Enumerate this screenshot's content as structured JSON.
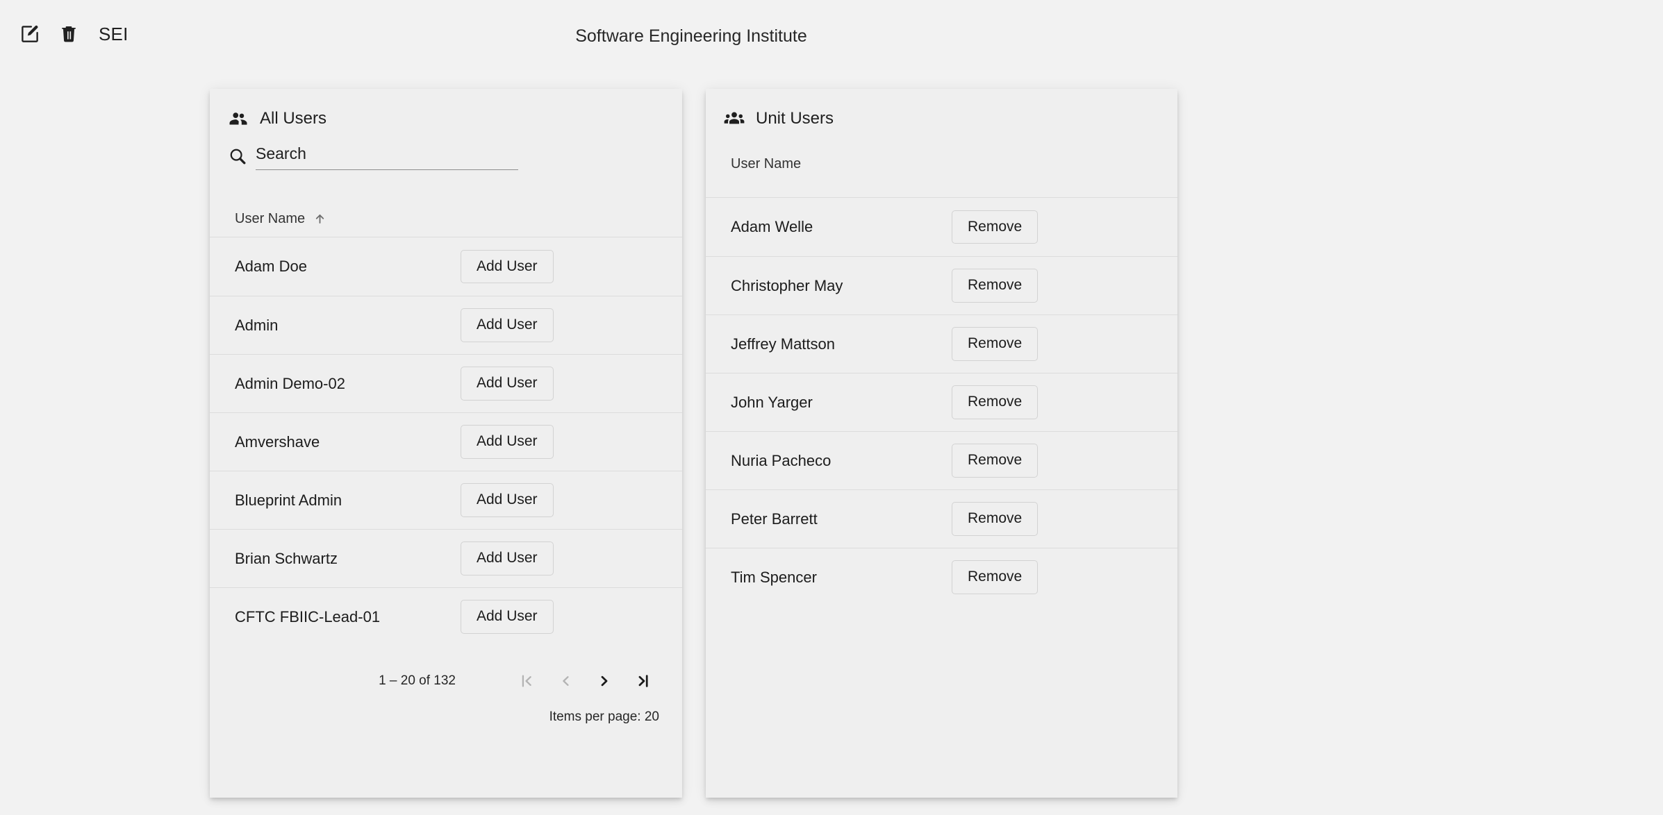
{
  "header": {
    "title": "Software Engineering Institute",
    "org_label": "SEI",
    "edit_icon": "edit-square-icon",
    "delete_icon": "trash-icon"
  },
  "all_users_panel": {
    "icon": "people-icon",
    "title": "All Users",
    "search": {
      "icon": "search-icon",
      "placeholder": "Search",
      "value": ""
    },
    "column_header": {
      "label": "User Name",
      "sort_icon": "arrow-upward-icon",
      "sort_direction": "ascending"
    },
    "action_label": "Add User",
    "rows": [
      {
        "name": "Adam Doe"
      },
      {
        "name": "Admin"
      },
      {
        "name": "Admin Demo-02"
      },
      {
        "name": "Amvershave"
      },
      {
        "name": "Blueprint Admin"
      },
      {
        "name": "Brian Schwartz"
      },
      {
        "name": "CFTC FBIIC-Lead-01"
      }
    ],
    "paginator": {
      "range_label": "1 – 20 of 132",
      "items_per_page_label": "Items per page: 20",
      "first_page_icon": "first-page-icon",
      "previous_page_icon": "chevron-left-icon",
      "next_page_icon": "chevron-right-icon",
      "last_page_icon": "last-page-icon",
      "first_page_enabled": false,
      "previous_page_enabled": false,
      "next_page_enabled": true,
      "last_page_enabled": true
    }
  },
  "unit_users_panel": {
    "icon": "groups-icon",
    "title": "Unit Users",
    "column_header": {
      "label": "User Name"
    },
    "action_label": "Remove",
    "rows": [
      {
        "name": "Adam Welle"
      },
      {
        "name": "Christopher May"
      },
      {
        "name": "Jeffrey Mattson"
      },
      {
        "name": "John Yarger"
      },
      {
        "name": "Nuria Pacheco"
      },
      {
        "name": "Peter Barrett"
      },
      {
        "name": "Tim Spencer"
      }
    ]
  },
  "colors": {
    "page_background": "#f2f2f2",
    "panel_background": "#efefef",
    "text_primary": "#1c1c1c",
    "divider": "#dcdcdc",
    "disabled": "#b3b3b3"
  }
}
